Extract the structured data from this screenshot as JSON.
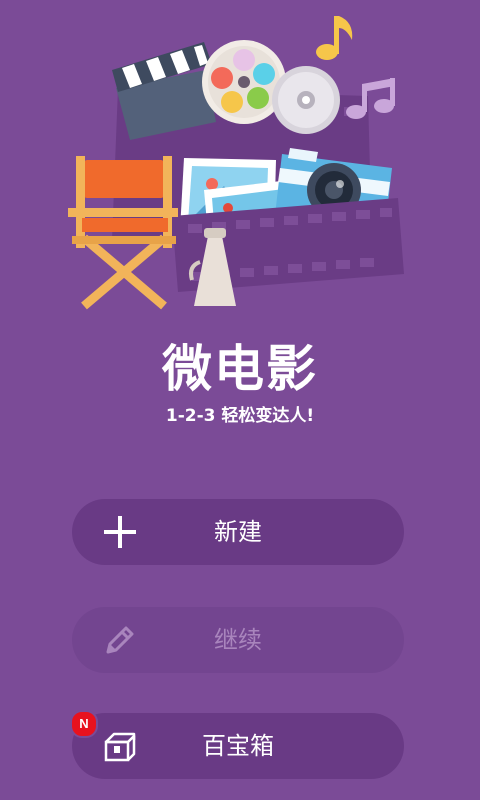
{
  "app": {
    "title": "微电影",
    "subtitle": "1-2-3 轻松变达人!"
  },
  "menu": {
    "new_label": "新建",
    "continue_label": "继续",
    "toolbox_label": "百宝箱",
    "toolbox_badge": "N"
  },
  "colors": {
    "background": "#7b4b97",
    "button": "#693a85",
    "badge": "#e8121e"
  },
  "icons": {
    "new": "plus-icon",
    "continue": "pencil-icon",
    "toolbox": "treasure-box-icon"
  }
}
